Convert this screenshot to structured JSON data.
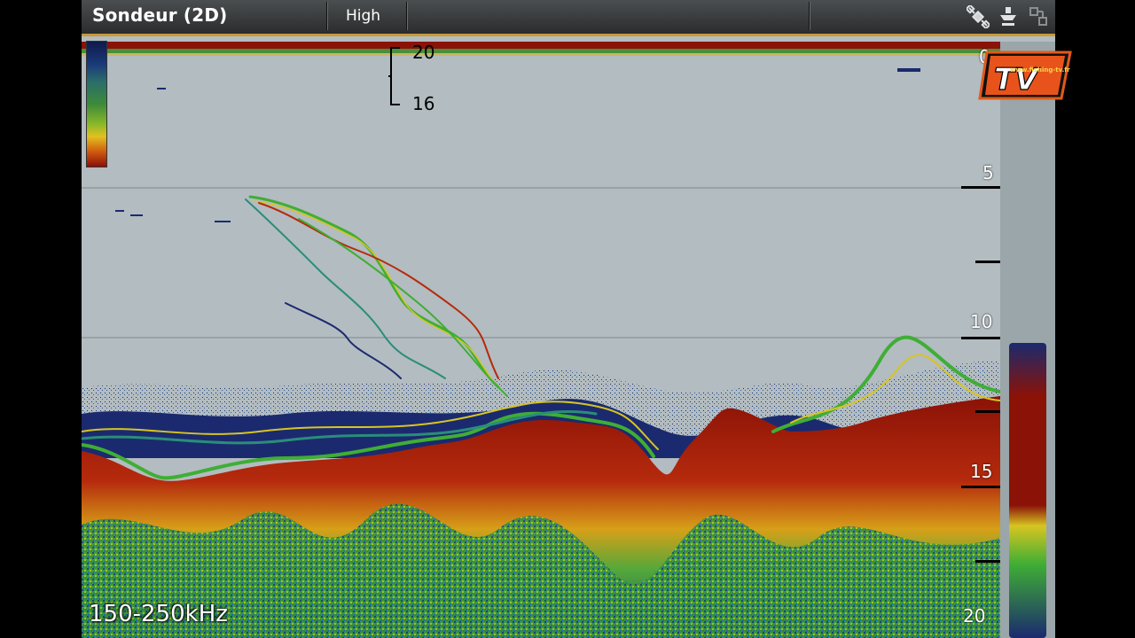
{
  "header": {
    "title": "Sondeur (2D)",
    "mode": "High"
  },
  "overlay": {
    "frequency": "150-250kHz",
    "zoom_top": "20",
    "zoom_bottom": "16"
  },
  "depth_scale": {
    "labels": [
      "0",
      "5",
      "10",
      "15",
      "20"
    ]
  },
  "logo": {
    "site": "www.fishing-tv.fr",
    "text": "TV"
  },
  "icons": {
    "gps": "satellite-icon",
    "sonar": "transducer-icon",
    "network": "network-icon"
  },
  "colors": {
    "accent": "#c99a3a",
    "water": "#b3bcc0",
    "bottom": "#8b1207",
    "green": "#3fae35",
    "blue": "#1b2a6e",
    "yellow": "#d7c521"
  }
}
